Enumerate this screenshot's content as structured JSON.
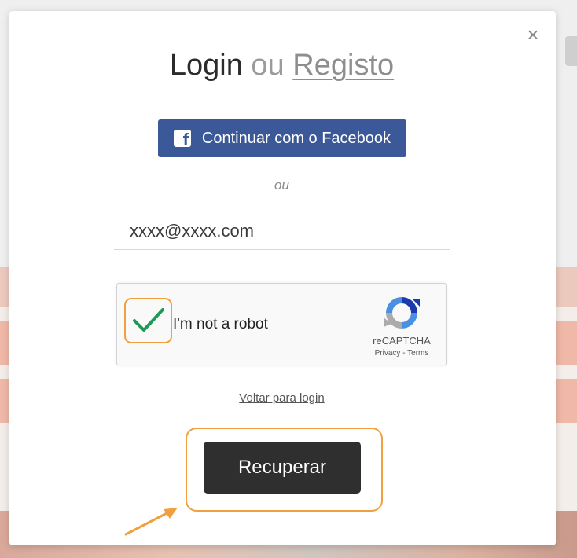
{
  "modal": {
    "close_icon": "×",
    "title_login": "Login",
    "title_sep": "ou",
    "title_register": "Registo",
    "facebook_button": "Continuar com o Facebook",
    "facebook_glyph": "f",
    "or_label": "ou",
    "email_value": "xxxx@xxxx.com",
    "recaptcha": {
      "label": "I'm not a robot",
      "brand": "reCAPTCHA",
      "links": "Privacy - Terms",
      "checked": true
    },
    "back_link": "Voltar para login",
    "recover_button": "Recuperar"
  },
  "colors": {
    "facebook": "#3b5998",
    "highlight": "#f0a040",
    "button_dark": "#2f2f2f",
    "check_green": "#1f9a55"
  },
  "icons": [
    "close-icon",
    "facebook-icon",
    "checkmark-icon",
    "recaptcha-logo-icon",
    "arrow-annotation-icon"
  ]
}
